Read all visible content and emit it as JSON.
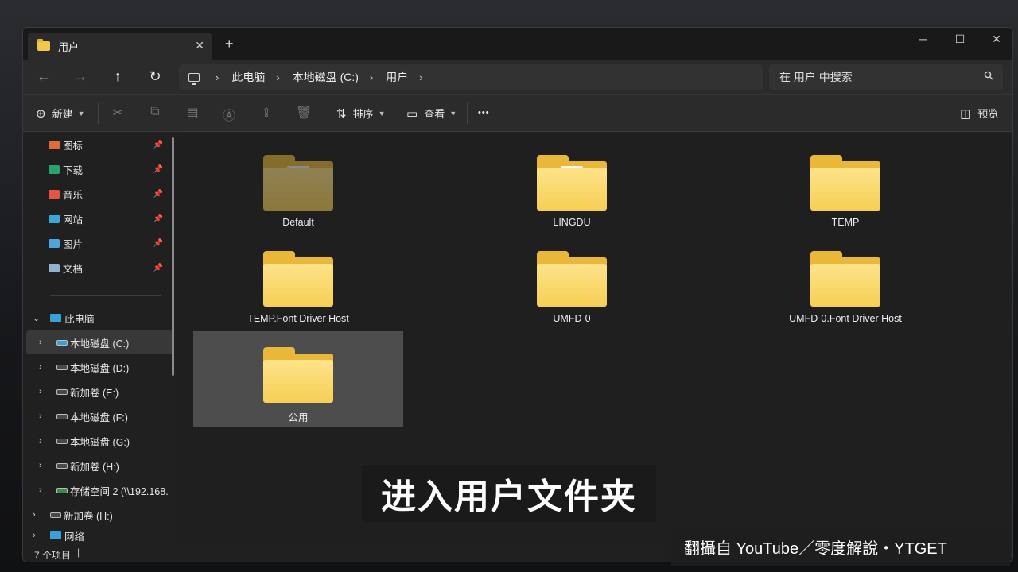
{
  "window": {
    "tab_title": "用户",
    "tab_close": "✕",
    "new_tab": "+",
    "controls": {
      "minimize": "─",
      "maximize": "☐",
      "close": "✕"
    }
  },
  "nav": {
    "back": "←",
    "forward": "→",
    "up": "↑",
    "refresh": "↻",
    "breadcrumbs": [
      "此电脑",
      "本地磁盘 (C:)",
      "用户"
    ],
    "separator": "›",
    "search_placeholder": "在 用户 中搜索"
  },
  "commandbar": {
    "new": "新建",
    "sort": "排序",
    "view": "查看",
    "more": "•••",
    "preview": "预览"
  },
  "sidebar": {
    "quick_access": [
      {
        "label": "图标",
        "color": "#e06b3a"
      },
      {
        "label": "下载",
        "color": "#27a36b"
      },
      {
        "label": "音乐",
        "color": "#e2563f"
      },
      {
        "label": "网站",
        "color": "#3ba6d9"
      },
      {
        "label": "图片",
        "color": "#4fa3e0"
      },
      {
        "label": "文档",
        "color": "#8fb2cf"
      }
    ],
    "this_pc": "此电脑",
    "drives": [
      "本地磁盘 (C:)",
      "本地磁盘 (D:)",
      "新加卷 (E:)",
      "本地磁盘 (F:)",
      "本地磁盘 (G:)",
      "新加卷 (H:)",
      "存储空间 2 (\\\\192.168."
    ],
    "extra": [
      "新加卷 (H:)",
      "网络"
    ]
  },
  "folders": [
    {
      "name": "Default",
      "dim": true,
      "paper": true
    },
    {
      "name": "LINGDU",
      "dim": false,
      "paper": true
    },
    {
      "name": "TEMP",
      "dim": false,
      "paper": false
    },
    {
      "name": "TEMP.Font Driver Host",
      "dim": false,
      "paper": false
    },
    {
      "name": "UMFD-0",
      "dim": false,
      "paper": false
    },
    {
      "name": "UMFD-0.Font Driver Host",
      "dim": false,
      "paper": false
    },
    {
      "name": "公用",
      "dim": false,
      "paper": false,
      "selected": true
    }
  ],
  "status": {
    "count": "7 个项目"
  },
  "overlay": {
    "subtitle": "进入用户文件夹",
    "watermark": "翻攝自 YouTube／零度解說・YTGET"
  }
}
